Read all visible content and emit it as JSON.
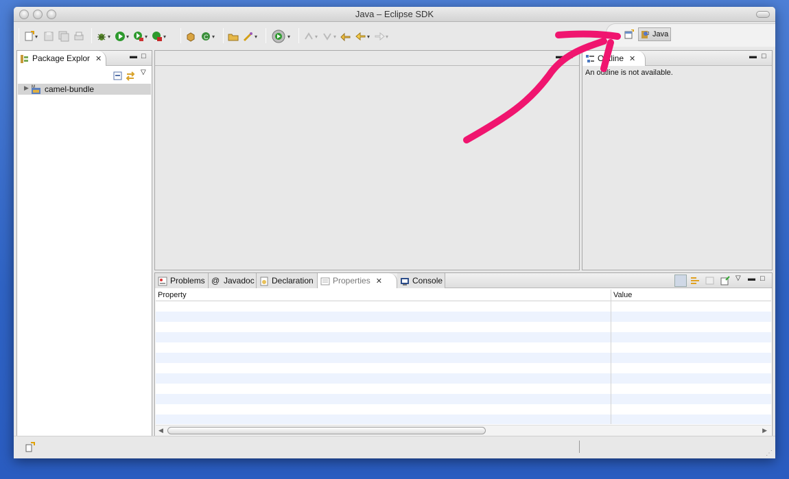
{
  "window": {
    "title": "Java – Eclipse SDK"
  },
  "perspective": {
    "label": "Java"
  },
  "package_explorer": {
    "tab_label": "Package Explor",
    "close_glyph": "✕",
    "tree": [
      {
        "label": "camel-bundle"
      }
    ]
  },
  "outline": {
    "tab_label": "Outline",
    "close_glyph": "✕",
    "message": "An outline is not available."
  },
  "bottom_tabs": [
    {
      "label": "Problems"
    },
    {
      "label": "Javadoc"
    },
    {
      "label": "Declaration"
    },
    {
      "label": "Properties",
      "close_glyph": "✕"
    },
    {
      "label": "Console"
    }
  ],
  "properties_table": {
    "columns": [
      "Property",
      "Value"
    ]
  },
  "annotation": {
    "color": "#f0156f"
  },
  "icons": {
    "toolbar": [
      "new-icon",
      "save-icon",
      "save-all-icon",
      "print-icon",
      "debug-icon",
      "run-icon",
      "run-coverage-icon",
      "external-tools-icon",
      "new-java-package-icon",
      "new-java-class-icon",
      "open-type-icon",
      "search-icon",
      "ant-icon",
      "prev-annotation-icon",
      "next-annotation-icon",
      "last-edit-icon",
      "back-icon",
      "forward-icon"
    ]
  }
}
